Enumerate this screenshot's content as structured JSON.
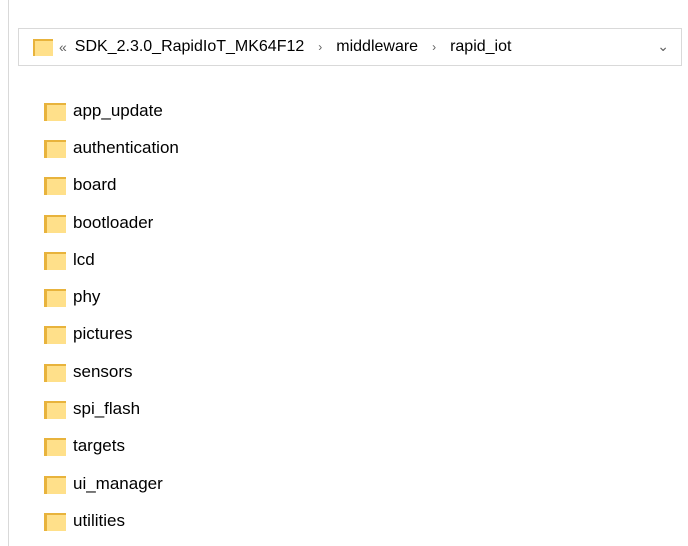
{
  "address_bar": {
    "overflow": "«",
    "breadcrumbs": [
      "SDK_2.3.0_RapidIoT_MK64F12",
      "middleware",
      "rapid_iot"
    ],
    "separator": "›",
    "dropdown": "⌄"
  },
  "files": [
    "app_update",
    "authentication",
    "board",
    "bootloader",
    "lcd",
    "phy",
    "pictures",
    "sensors",
    "spi_flash",
    "targets",
    "ui_manager",
    "utilities"
  ],
  "colors": {
    "folder_front": "#FFE08A",
    "folder_back": "#E8B33C",
    "border": "#D9D9D9"
  }
}
